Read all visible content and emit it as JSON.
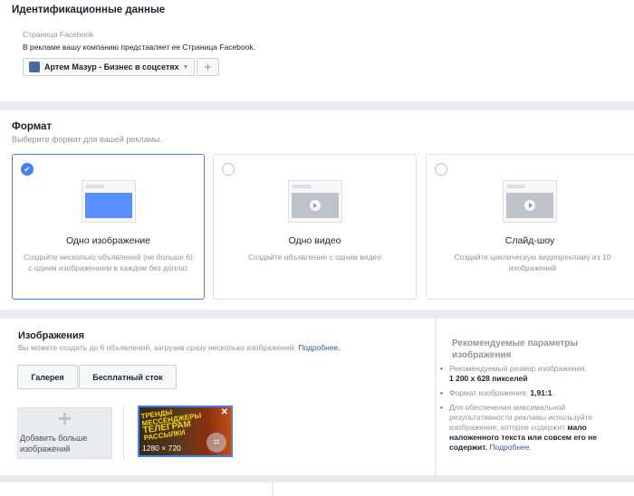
{
  "identity": {
    "title": "Идентификационные данные",
    "fb_label": "Страница Facebook",
    "fb_desc": "В рекламе вашу компанию представляет ее Страница Facebook.",
    "page_select": "Артем Мазур - Бизнес в соцсетях",
    "add": "+"
  },
  "format": {
    "title": "Формат",
    "subtitle": "Выберите формат для вашей рекламы.",
    "options": [
      {
        "title": "Одно изображение",
        "desc": "Создайте несколько объявлений (не больше 6) с одним изображением в каждом без доплат",
        "selected": true
      },
      {
        "title": "Одно видео",
        "desc": "Создайте объявление с одним видео",
        "selected": false
      },
      {
        "title": "Слайд-шоу",
        "desc": "Создайте циклическую видеорекламу из 10 изображений",
        "selected": false
      }
    ]
  },
  "images": {
    "title": "Изображения",
    "subtitle": "Вы можете создать до 6 объявлений, загрузив сразу несколько изображений.",
    "more_link": "Подробнее.",
    "tabs": [
      "Галерея",
      "Бесплатный сток"
    ],
    "add_more": "Добавить больше изображений",
    "thumb_size": "1280 × 720",
    "thumb_text": [
      "ТРЕНДЫ",
      "МЕССЕНДЖЕРЫ",
      "ТЕЛЕГРАМ",
      "РАССЫЛКИ"
    ]
  },
  "recommend": {
    "title": "Рекомендуемые параметры изображения",
    "size_label": "Рекомендуемый размер изображения:",
    "size_value": "1 200 x 628 пикселей",
    "ratio_label": "Формат изображения:",
    "ratio_value": "1,91:1",
    "tip_pre": "Для обеспечения максимальной результативности рекламы используйте изображение, которое содержит",
    "tip_bold": "мало наложенного текста или совсем его не содержит.",
    "tip_link": "Подробнее."
  },
  "colors": {
    "accent": "#4080ff",
    "link": "#365899",
    "background": "#e9ebee"
  }
}
